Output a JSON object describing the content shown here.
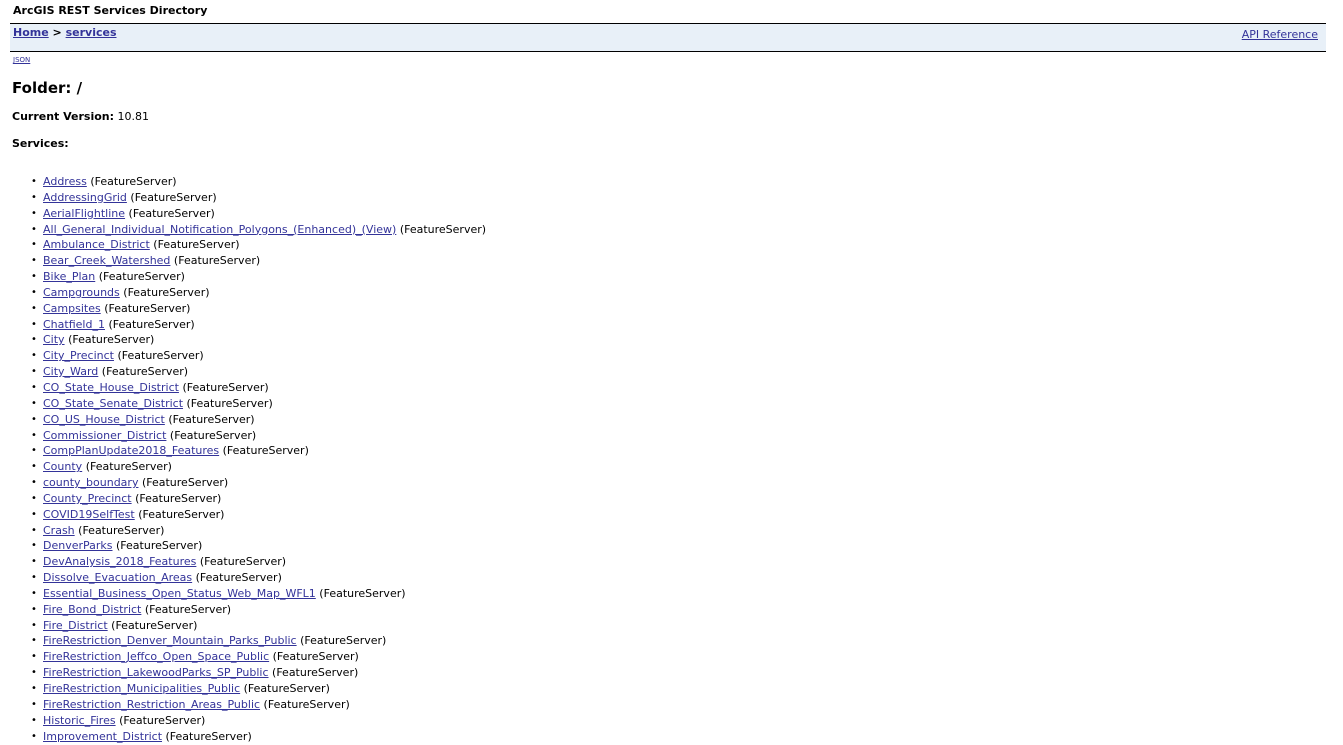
{
  "header": {
    "title": "ArcGIS REST Services Directory"
  },
  "nav": {
    "home_label": "Home",
    "separator": ">",
    "services_label": "services",
    "api_reference_label": "API Reference"
  },
  "json_link_label": "JSON",
  "folder": {
    "heading": "Folder: /"
  },
  "version": {
    "label": "Current Version:",
    "value": "10.81"
  },
  "services_label": "Services:",
  "services": [
    {
      "name": "Address",
      "type": "(FeatureServer)"
    },
    {
      "name": "AddressingGrid",
      "type": "(FeatureServer)"
    },
    {
      "name": "AerialFlightline",
      "type": "(FeatureServer)"
    },
    {
      "name": "All_General_Individual_Notification_Polygons_(Enhanced)_(View)",
      "type": "(FeatureServer)"
    },
    {
      "name": "Ambulance_District",
      "type": "(FeatureServer)"
    },
    {
      "name": "Bear_Creek_Watershed",
      "type": "(FeatureServer)"
    },
    {
      "name": "Bike_Plan",
      "type": "(FeatureServer)"
    },
    {
      "name": "Campgrounds",
      "type": "(FeatureServer)"
    },
    {
      "name": "Campsites",
      "type": "(FeatureServer)"
    },
    {
      "name": "Chatfield_1",
      "type": "(FeatureServer)"
    },
    {
      "name": "City",
      "type": "(FeatureServer)"
    },
    {
      "name": "City_Precinct",
      "type": "(FeatureServer)"
    },
    {
      "name": "City_Ward",
      "type": "(FeatureServer)"
    },
    {
      "name": "CO_State_House_District",
      "type": "(FeatureServer)"
    },
    {
      "name": "CO_State_Senate_District",
      "type": "(FeatureServer)"
    },
    {
      "name": "CO_US_House_District",
      "type": "(FeatureServer)"
    },
    {
      "name": "Commissioner_District",
      "type": "(FeatureServer)"
    },
    {
      "name": "CompPlanUpdate2018_Features",
      "type": "(FeatureServer)"
    },
    {
      "name": "County",
      "type": "(FeatureServer)"
    },
    {
      "name": "county_boundary",
      "type": "(FeatureServer)"
    },
    {
      "name": "County_Precinct",
      "type": "(FeatureServer)"
    },
    {
      "name": "COVID19SelfTest",
      "type": "(FeatureServer)"
    },
    {
      "name": "Crash",
      "type": "(FeatureServer)"
    },
    {
      "name": "DenverParks",
      "type": "(FeatureServer)"
    },
    {
      "name": "DevAnalysis_2018_Features",
      "type": "(FeatureServer)"
    },
    {
      "name": "Dissolve_Evacuation_Areas",
      "type": "(FeatureServer)"
    },
    {
      "name": "Essential_Business_Open_Status_Web_Map_WFL1",
      "type": "(FeatureServer)"
    },
    {
      "name": "Fire_Bond_District",
      "type": "(FeatureServer)"
    },
    {
      "name": "Fire_District",
      "type": "(FeatureServer)"
    },
    {
      "name": "FireRestriction_Denver_Mountain_Parks_Public",
      "type": "(FeatureServer)"
    },
    {
      "name": "FireRestriction_Jeffco_Open_Space_Public",
      "type": "(FeatureServer)"
    },
    {
      "name": "FireRestriction_LakewoodParks_SP_Public",
      "type": "(FeatureServer)"
    },
    {
      "name": "FireRestriction_Municipalities_Public",
      "type": "(FeatureServer)"
    },
    {
      "name": "FireRestriction_Restriction_Areas_Public",
      "type": "(FeatureServer)"
    },
    {
      "name": "Historic_Fires",
      "type": "(FeatureServer)"
    },
    {
      "name": "Improvement_District",
      "type": "(FeatureServer)"
    }
  ]
}
